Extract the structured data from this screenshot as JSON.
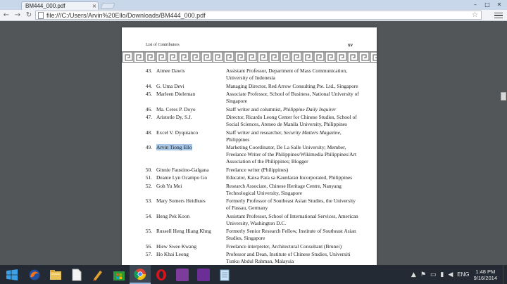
{
  "browser": {
    "tab_title": "BM444_000.pdf",
    "tab_close": "×",
    "url": "file:///C:/Users/Arvin%20Ello/Downloads/BM444_000.pdf",
    "back": "←",
    "forward": "→",
    "reload": "↻",
    "star": "☆",
    "min": "–",
    "max": "□",
    "close": "✕"
  },
  "pdf": {
    "running_head": "List of Contributors",
    "page_number": "xv",
    "entries": [
      {
        "num": "43.",
        "name": "Aimee Dawis",
        "desc": "Assistant Professor, Department of Mass Communication, University of Indonesia"
      },
      {
        "num": "44.",
        "name": "G. Uma Devi",
        "desc": "Managing Director, Red Arrow Consulting Pte. Ltd., Singapore"
      },
      {
        "num": "45.",
        "name": "Marleen Dieleman",
        "desc": "Associate Professor, School of Business, National University of Singapore"
      },
      {
        "num": "46.",
        "name": "Ma. Ceres P. Doyo",
        "desc_pre": "Staff writer and columnist, ",
        "desc_it": "Philippine Daily Inquirer",
        "desc_post": ""
      },
      {
        "num": "47.",
        "name": "Aristotle Dy, S.J.",
        "desc": "Director, Ricardo Leong Center for Chinese Studies, School of Social Sciences, Ateneo de Manila University, Philippines"
      },
      {
        "num": "48.",
        "name": "Excel V. Dyquianco",
        "desc_pre": "Staff writer and researcher, ",
        "desc_it": "Security Matters Magazine",
        "desc_post": ", Philippines"
      },
      {
        "num": "49.",
        "name": "Arvin Tiong Ello",
        "desc": "Marketing Coordinator, De La Salle University; Member, Freelance Writer of the Philippines/Wikimedia Philippines/Art Association of the Philippines; Blogger"
      },
      {
        "num": "50.",
        "name": "Ginnie Faustino-Galgana",
        "desc": "Freelance writer (Philippines)"
      },
      {
        "num": "51.",
        "name": "Deanie Lyn Ocampo Go",
        "desc": "Educator, Kaisa Para sa Kaunlaran Incorporated, Philippines"
      },
      {
        "num": "52.",
        "name": "Goh Yu Mei",
        "desc": "Research Associate, Chinese Heritage Centre, Nanyang Technological University, Singapore"
      },
      {
        "num": "53.",
        "name": "Mary Somers Heidhues",
        "desc": "Formerly Professor of Southeast Asian Studies, the University of Passau, Germany"
      },
      {
        "num": "54.",
        "name": "Heng Pek Koon",
        "desc": "Assistant Professor, School of International Services, American University, Washington D.C."
      },
      {
        "num": "55.",
        "name": "Russell Heng Hiang Khng",
        "desc": "Formerly Senior Research Fellow, Institute of Southeast Asian Studies, Singapore"
      },
      {
        "num": "56.",
        "name": "Hiew Swee Kwang",
        "desc": "Freelance interpreter, Architectural Consultant (Brunei)"
      },
      {
        "num": "57.",
        "name": "Ho Khai Leong",
        "desc": "Professor and Dean, Institute of Chinese Studies, Universiti Tunku Abdul Rahman, Malaysia"
      }
    ]
  },
  "taskbar": {
    "language": "ENG",
    "time": "1:48 PM",
    "date": "9/16/2014",
    "apps": [
      "firefox-icon",
      "file-explorer-icon",
      "document-icon",
      "paint-icon",
      "store-icon",
      "chrome-icon",
      "opera-icon",
      "onenote-icon",
      "media-icon",
      "notepad-icon"
    ]
  }
}
